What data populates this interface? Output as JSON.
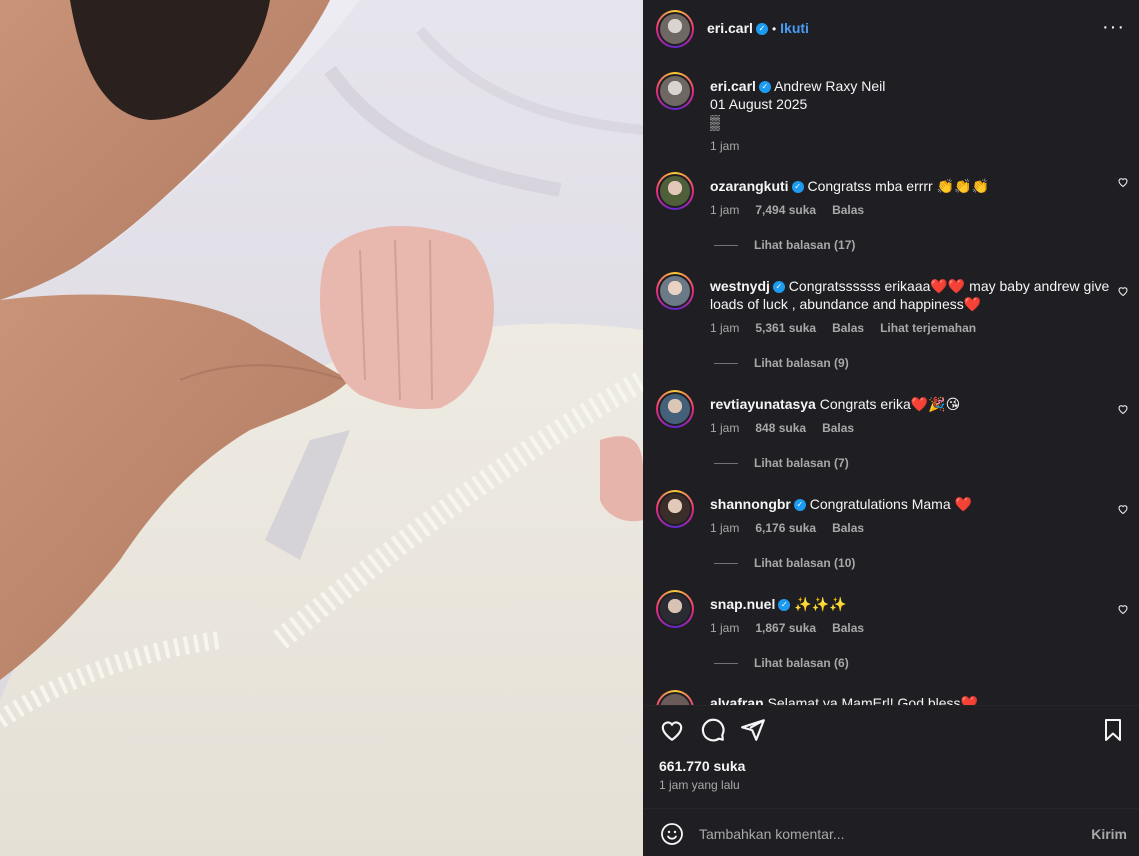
{
  "header": {
    "username": "eri.carl",
    "follow_label": "Ikuti",
    "more_icon": "more-horizontal-icon"
  },
  "caption": {
    "username": "eri.carl",
    "line1": "Andrew Raxy Neil",
    "line2": "01 August 2025",
    "line3": "▒",
    "time": "1 jam"
  },
  "comments": [
    {
      "username": "ozarangkuti",
      "text": "Congratss mba errrr 👏👏👏",
      "time": "1 jam",
      "likes": "7,494 suka",
      "reply": "Balas",
      "replies": "Lihat balasan (17)"
    },
    {
      "username": "westnydj",
      "text": "Congratssssss erikaaa❤️❤️ may baby andrew give loads of luck , abundance and happiness❤️",
      "time": "1 jam",
      "likes": "5,361 suka",
      "reply": "Balas",
      "translate": "Lihat terjemahan",
      "replies": "Lihat balasan (9)"
    },
    {
      "username": "revtiayunatasya",
      "text": "Congrats erika❤️🎉😘",
      "time": "1 jam",
      "likes": "848 suka",
      "reply": "Balas",
      "replies": "Lihat balasan (7)"
    },
    {
      "username": "shannongbr",
      "text": "Congratulations Mama ❤️",
      "time": "1 jam",
      "likes": "6,176 suka",
      "reply": "Balas",
      "replies": "Lihat balasan (10)"
    },
    {
      "username": "snap.nuel",
      "text": "✨✨✨",
      "time": "1 jam",
      "likes": "1,867 suka",
      "reply": "Balas",
      "replies": "Lihat balasan (6)"
    },
    {
      "username": "alvafran",
      "text": "Selamat ya MamErl! God bless❤️"
    }
  ],
  "footer": {
    "likes": "661.770 suka",
    "ago": "1 jam yang lalu",
    "comment_placeholder": "Tambahkan komentar...",
    "send_label": "Kirim"
  },
  "colors": {
    "background": "#1f1f23",
    "accent": "#4a9bf5",
    "verified": "#1d9bf0",
    "muted_text": "#a8a8a8"
  }
}
